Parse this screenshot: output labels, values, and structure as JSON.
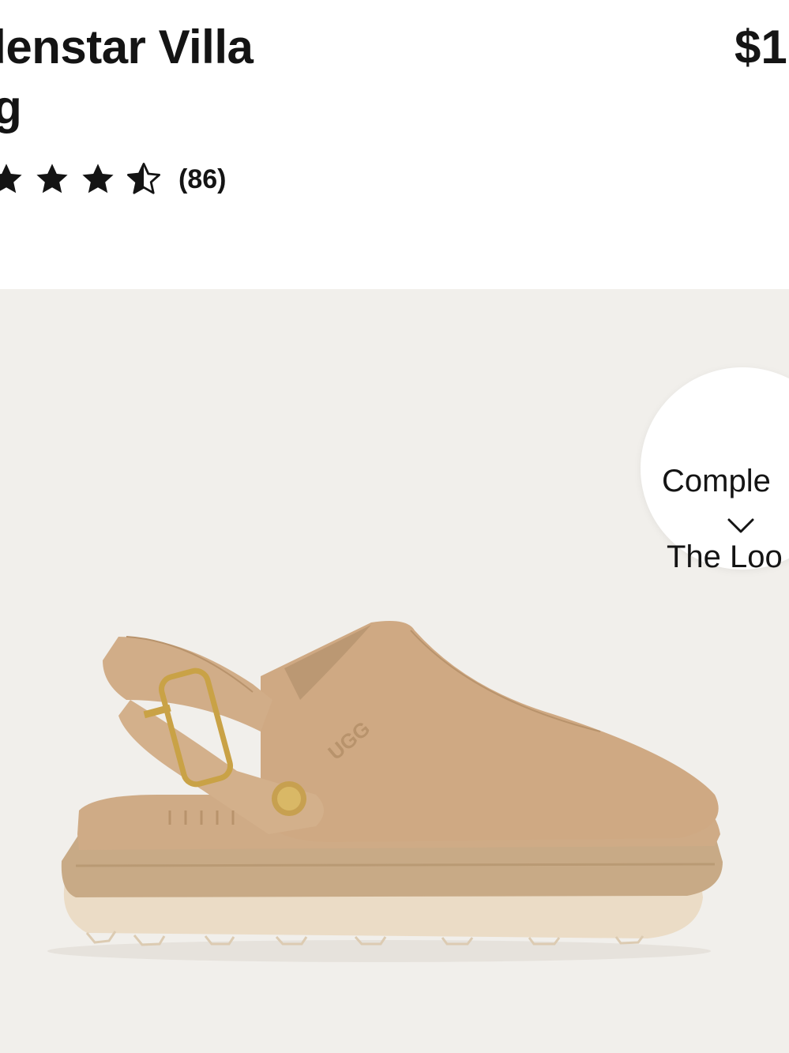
{
  "product": {
    "title_line1": "ldenstar Villa",
    "title_line2": "og",
    "price": "$1"
  },
  "rating": {
    "stars": 3.5,
    "review_count": "(86)"
  },
  "complete_look": {
    "line1": "Comple",
    "line2": "The Loo",
    "icon": "chevron-down-icon"
  },
  "colors": {
    "gallery_bg": "#f1efeb",
    "shoe_tan": "#cfab86",
    "sole": "#ebdcc6"
  }
}
